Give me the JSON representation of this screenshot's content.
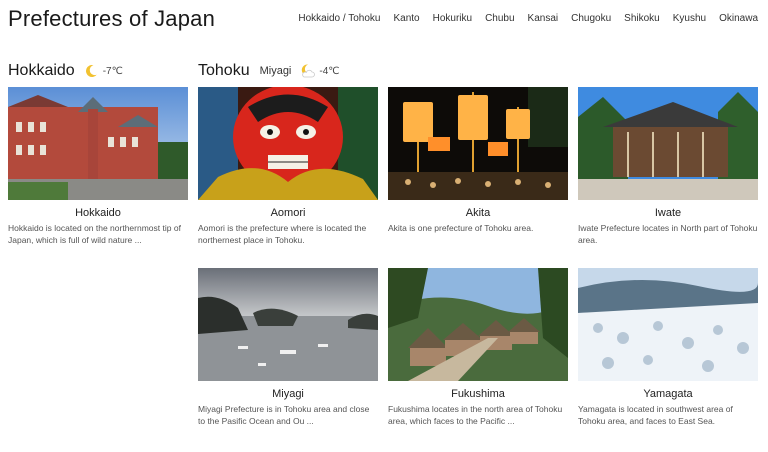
{
  "header": {
    "title": "Prefectures of Japan",
    "nav": [
      "Hokkaido / Tohoku",
      "Kanto",
      "Hokuriku",
      "Chubu",
      "Kansai",
      "Chugoku",
      "Shikoku",
      "Kyushu",
      "Okinawa"
    ]
  },
  "sections": {
    "hokkaido": {
      "title": "Hokkaido",
      "weather_icon": "moon-icon",
      "temp": "-7℃"
    },
    "tohoku": {
      "title": "Tohoku",
      "region": "Miyagi",
      "weather_icon": "moon-cloud-icon",
      "temp": "-4℃"
    }
  },
  "cards": [
    {
      "title": "Hokkaido",
      "desc": "Hokkaido is located on the northernmost tip of Japan, which is full of wild nature ..."
    },
    {
      "title": "Aomori",
      "desc": "Aomori is the prefecture where is located the northernest place in Tohoku."
    },
    {
      "title": "Akita",
      "desc": "Akita is one prefecture of Tohoku area."
    },
    {
      "title": "Iwate",
      "desc": "Iwate Prefecture locates in North part of Tohoku area."
    },
    {
      "title": "Miyagi",
      "desc": "Miyagi Prefecture is in Tohoku area and close to the Pasific Ocean and Ou ..."
    },
    {
      "title": "Fukushima",
      "desc": "Fukushima locates in the north area of Tohoku area, which faces to the Pacific ..."
    },
    {
      "title": "Yamagata",
      "desc": "Yamagata is located in southwest area of Tohoku area, and faces to East Sea."
    }
  ],
  "colors": {
    "moon": "#f2c230",
    "text": "#222222"
  }
}
